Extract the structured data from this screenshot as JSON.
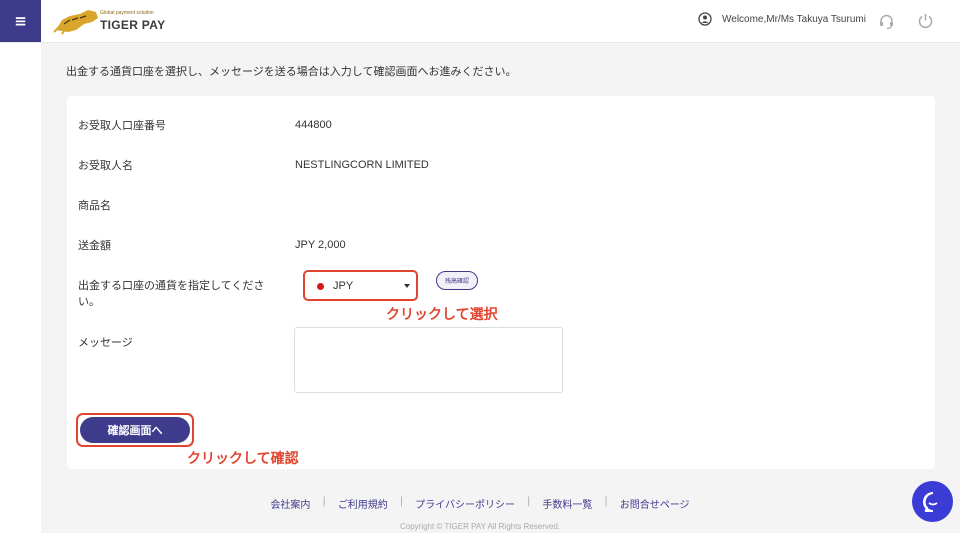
{
  "header": {
    "menu_icon": "hamburger-icon",
    "logo_tagline": "Global payment solution",
    "logo_text": "TIGER PAY",
    "welcome_text": "Welcome,Mr/Ms Takuya Tsurumi"
  },
  "instruction": "出金する通貨口座を選択し、メッセージを送る場合は入力して確認画面へお進みください。",
  "form": {
    "account_number_label": "お受取人口座番号",
    "account_number_value": "444800",
    "recipient_label": "お受取人名",
    "recipient_value": "NESTLINGCORN LIMITED",
    "product_label": "商品名",
    "amount_label": "送金額",
    "amount_value": "JPY 2,000",
    "currency_label_line1": "出金する口座の通貨を指定してくださ",
    "currency_label_line2": "い。",
    "currency_selected": "JPY",
    "balance_button": "残高確認",
    "message_label": "メッセージ",
    "confirm_button": "確認画面へ"
  },
  "annotations": {
    "select_hint": "クリックして選択",
    "confirm_hint": "クリックして確認"
  },
  "footer": {
    "links": [
      "会社案内",
      "ご利用規約",
      "プライバシーポリシー",
      "手数料一覧",
      "お問合せページ"
    ],
    "copyright": "Copyright © TIGER PAY All Rights Reserved."
  },
  "colors": {
    "brand": "#3f3b8c",
    "annotation": "#e0452f",
    "chat": "#3b3bd6"
  }
}
